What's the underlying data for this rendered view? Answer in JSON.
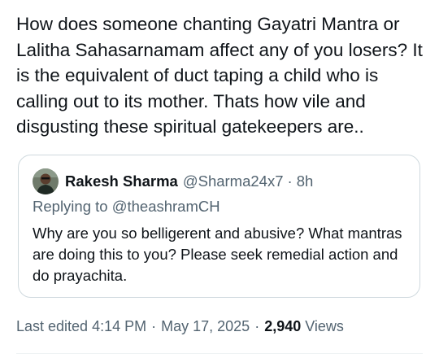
{
  "tweet": {
    "text": "How does someone chanting Gayatri Mantra or Lalitha Sahasarnamam affect any of you losers? It is the equivalent of duct taping a child who is calling out to its mother. Thats how vile and disgusting these spiritual gatekeepers are.."
  },
  "quote": {
    "author_name": "Rakesh Sharma",
    "author_handle": "@Sharma24x7",
    "separator": "·",
    "time": "8h",
    "replying_to": "Replying to @theashramCH",
    "text": "Why are you so belligerent and abusive? What mantras are doing this to you? Please seek remedial action and do prayachita."
  },
  "meta": {
    "edited": "Last edited 4:14 PM",
    "separator": "·",
    "date": "May 17, 2025",
    "views_count": "2,940",
    "views_label": "Views"
  },
  "colors": {
    "text_primary": "#0f1419",
    "text_secondary": "#536471",
    "border": "#cfd9de"
  }
}
